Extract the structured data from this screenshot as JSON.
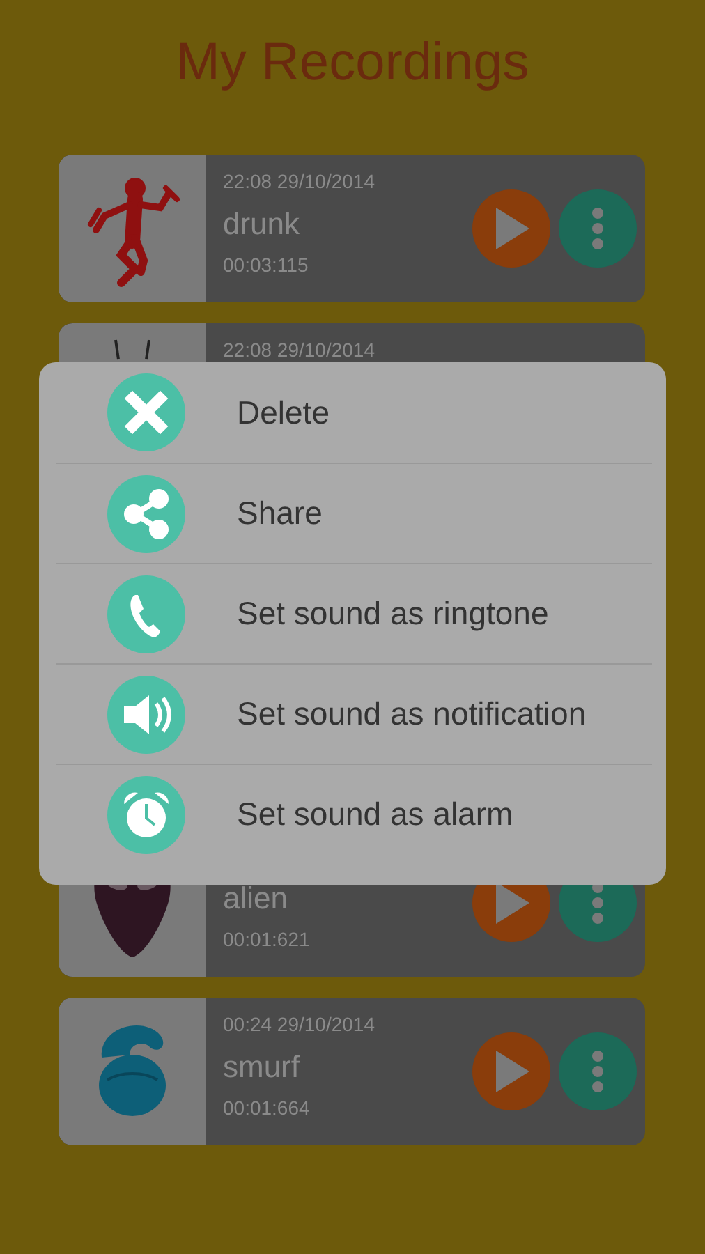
{
  "title": "My Recordings",
  "recordings": [
    {
      "time": "22:08 29/10/2014",
      "name": "drunk",
      "duration": "00:03:115"
    },
    {
      "time": "22:08 29/10/2014"
    },
    {
      "name": "alien",
      "duration": "00:01:621"
    },
    {
      "time": "00:24 29/10/2014",
      "name": "smurf",
      "duration": "00:01:664"
    }
  ],
  "menu": [
    {
      "label": "Delete"
    },
    {
      "label": "Share"
    },
    {
      "label": "Set sound as ringtone"
    },
    {
      "label": "Set sound as notification"
    },
    {
      "label": "Set sound as alarm"
    }
  ]
}
